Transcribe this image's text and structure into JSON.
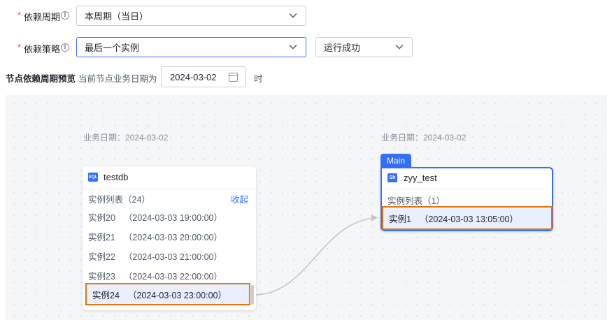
{
  "form": {
    "cycle": {
      "required_mark": "*",
      "label": "依赖周期",
      "value": "本周期（当日）"
    },
    "strategy": {
      "required_mark": "*",
      "label": "依赖策略",
      "value": "最后一个实例",
      "status_value": "运行成功"
    }
  },
  "preview": {
    "title": "节点依赖周期预览",
    "subtitle": "当前节点业务日期为",
    "date": "2024-03-02",
    "suffix": "时"
  },
  "upstream": {
    "date_caption": "业务日期：2024-03-02",
    "icon_text": "SQL",
    "name": "testdb",
    "list_title": "实例列表（24）",
    "collapse_label": "收起",
    "instances": [
      {
        "name": "实例20",
        "time": "（2024-03-03 19:00:00）"
      },
      {
        "name": "实例21",
        "time": "（2024-03-03 20:00:00）"
      },
      {
        "name": "实例22",
        "time": "（2024-03-03 21:00:00）"
      },
      {
        "name": "实例23",
        "time": "（2024-03-03 22:00:00）"
      },
      {
        "name": "实例24",
        "time": "（2024-03-03 23:00:00）"
      }
    ]
  },
  "downstream": {
    "date_caption": "业务日期：2024-03-02",
    "tag": "Main",
    "icon_text": "Sh",
    "name": "zyy_test",
    "list_title": "实例列表（1）",
    "instances": [
      {
        "name": "实例1",
        "time": "（2024-03-03 13:05:00）"
      }
    ]
  },
  "colors": {
    "accent": "#3370ff",
    "highlight": "#e8720c",
    "required": "#f53f3f"
  }
}
